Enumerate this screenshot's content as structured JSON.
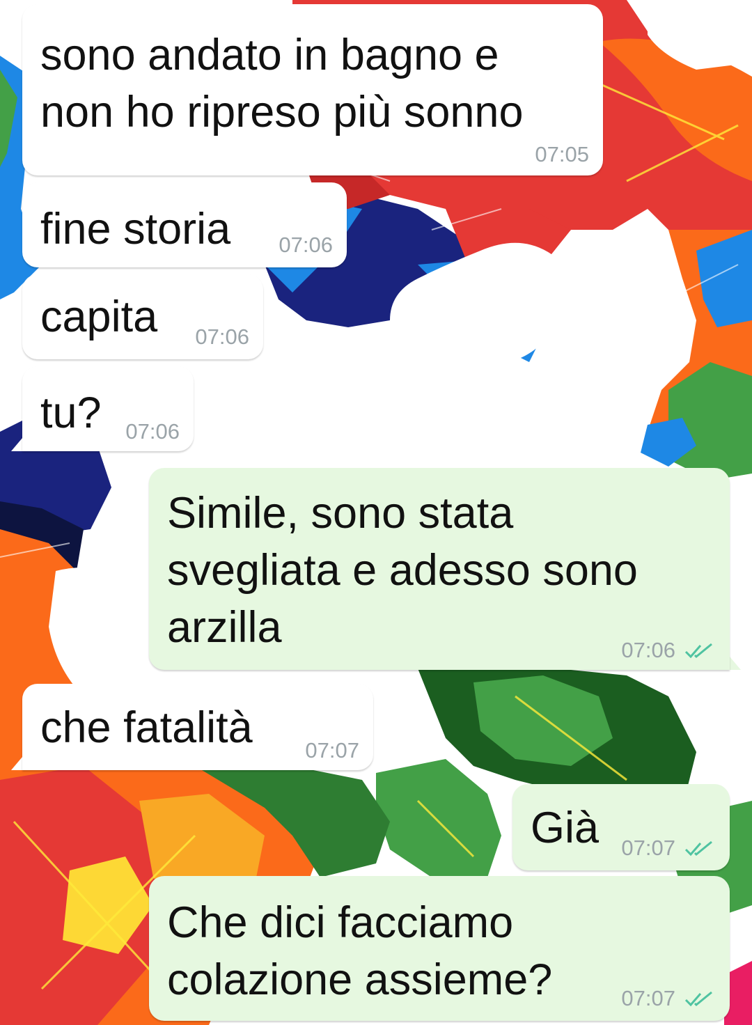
{
  "chat": {
    "messages": [
      {
        "direction": "incoming",
        "text_lines": [
          "sono andato in bagno e",
          "non ho ripreso più sonno"
        ],
        "time": "07:05"
      },
      {
        "direction": "incoming",
        "text_lines": [
          "fine storia"
        ],
        "time": "07:06"
      },
      {
        "direction": "incoming",
        "text_lines": [
          "capita"
        ],
        "time": "07:06"
      },
      {
        "direction": "incoming",
        "text_lines": [
          "tu?"
        ],
        "time": "07:06"
      },
      {
        "direction": "outgoing",
        "text_lines": [
          "Simile, sono stata",
          "svegliata e adesso sono",
          "arzilla"
        ],
        "time": "07:06",
        "status_icon": "double-check-icon"
      },
      {
        "direction": "incoming",
        "text_lines": [
          "che fatalità"
        ],
        "time": "07:07"
      },
      {
        "direction": "outgoing",
        "text_lines": [
          "Già"
        ],
        "time": "07:07",
        "status_icon": "double-check-icon"
      },
      {
        "direction": "outgoing",
        "text_lines": [
          "Che dici facciamo",
          "colazione assieme?"
        ],
        "time": "07:07",
        "status_icon": "double-check-icon"
      }
    ]
  },
  "colors": {
    "incoming_bubble": "#ffffff",
    "outgoing_bubble": "#e6f8e0",
    "timestamp": "#9aa3a8",
    "read_ticks": "#4fc3a1",
    "wallpaper": [
      "#e53935",
      "#fb6a1a",
      "#1e88e5",
      "#1a237e",
      "#43a047",
      "#1b5e20",
      "#ffffff"
    ]
  }
}
